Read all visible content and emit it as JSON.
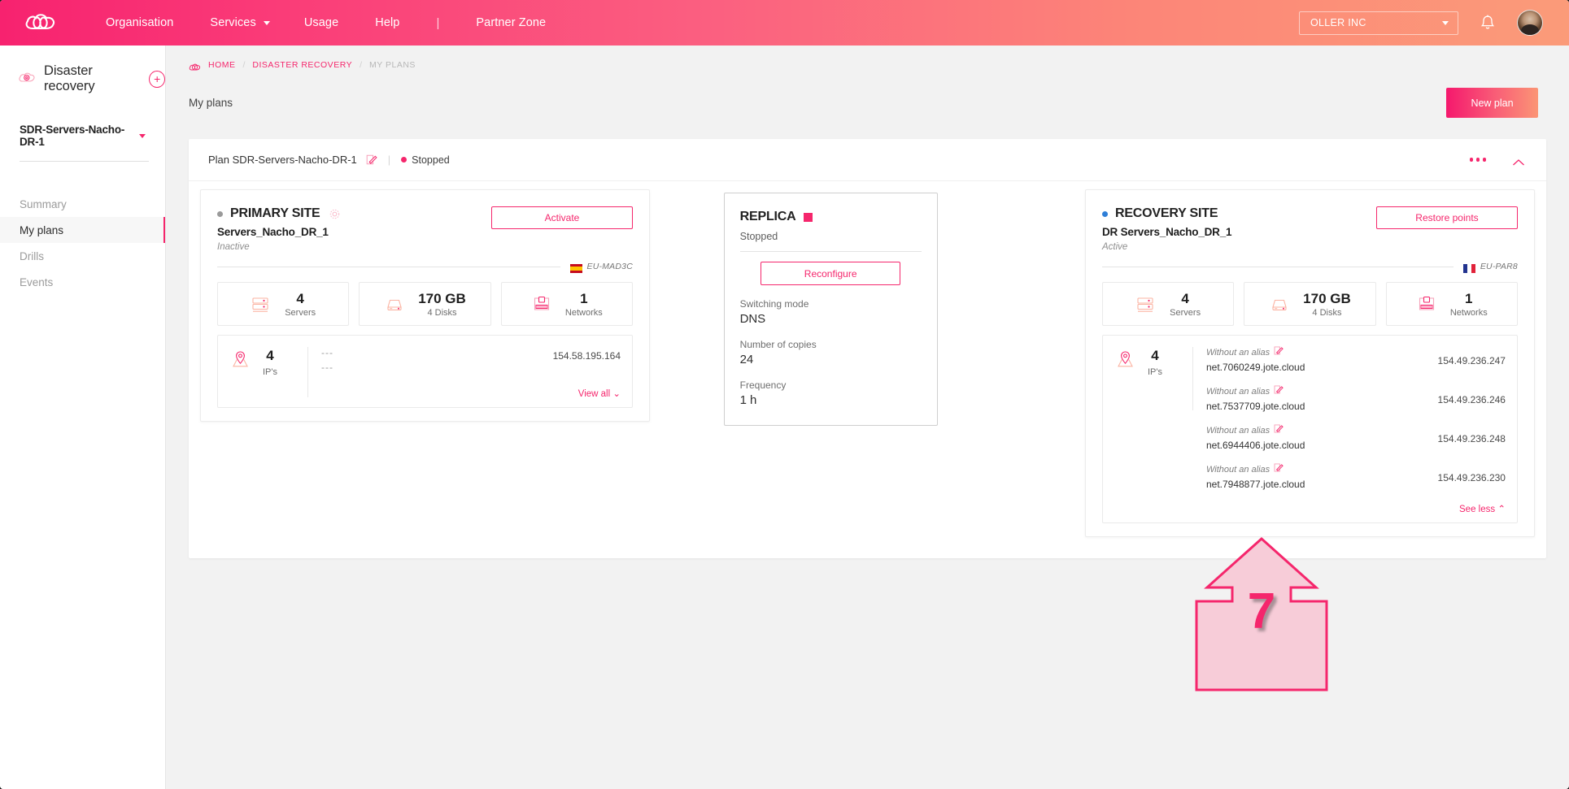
{
  "topnav": {
    "logo_icon": "cloud-logo-icon",
    "links": [
      {
        "label": "Organisation",
        "caret": false
      },
      {
        "label": "Services",
        "caret": true
      },
      {
        "label": "Usage",
        "caret": false
      },
      {
        "label": "Help",
        "caret": false
      }
    ],
    "separator": "|",
    "partner_link": "Partner Zone",
    "org_selector": "OLLER INC",
    "bell_icon": "notification-bell-icon",
    "avatar_icon": "user-avatar"
  },
  "sidebar": {
    "service_icon": "disaster-recovery-cloud-icon",
    "service_title": "Disaster recovery",
    "add_label": "+",
    "plan_selector": "SDR-Servers-Nacho-DR-1",
    "items": [
      {
        "label": "Summary",
        "active": false
      },
      {
        "label": "My plans",
        "active": true
      },
      {
        "label": "Drills",
        "active": false
      },
      {
        "label": "Events",
        "active": false
      }
    ]
  },
  "breadcrumb": {
    "home_icon": "home-cloud-icon",
    "items": [
      "HOME",
      "DISASTER RECOVERY",
      "MY PLANS"
    ],
    "separator": "/"
  },
  "page": {
    "title": "My plans",
    "new_plan_label": "New plan"
  },
  "plan_bar": {
    "title": "Plan SDR-Servers-Nacho-DR-1",
    "edit_icon": "edit-pencil-icon",
    "separator": "|",
    "status": "Stopped",
    "status_color": "#f5266c",
    "more_icon": "more-options-icon",
    "collapse_icon": "chevron-up-icon"
  },
  "primary_site": {
    "bullet_color": "#9a9a9a",
    "title": "PRIMARY SITE",
    "gear_icon": "gear-icon",
    "name": "Servers_Nacho_DR_1",
    "state": "Inactive",
    "action_label": "Activate",
    "flag_icon": "flag-spain-icon",
    "region": "EU-MAD3C",
    "stats": [
      {
        "icon": "server-rack-icon",
        "value": "4",
        "label": "Servers"
      },
      {
        "icon": "disk-icon",
        "value": "170 GB",
        "label": "4 Disks"
      },
      {
        "icon": "network-icon",
        "value": "1",
        "label": "Networks"
      }
    ],
    "ip_icon": "map-pin-icon",
    "ip_count": "4",
    "ip_label": "IP's",
    "ip_entries": [
      {
        "alias": "---",
        "host": "---",
        "ip": "154.58.195.164"
      }
    ],
    "expand_label": "View all"
  },
  "replica": {
    "title": "REPLICA",
    "status_color": "#f5266c",
    "state": "Stopped",
    "reconfigure_label": "Reconfigure",
    "fields": [
      {
        "label": "Switching mode",
        "value": "DNS"
      },
      {
        "label": "Number of copies",
        "value": "24"
      },
      {
        "label": "Frequency",
        "value": "1 h"
      }
    ]
  },
  "recovery_site": {
    "bullet_color": "#2f7fd8",
    "title": "RECOVERY SITE",
    "name": "DR Servers_Nacho_DR_1",
    "state": "Active",
    "action_label": "Restore points",
    "flag_icon": "flag-france-icon",
    "region": "EU-PAR8",
    "stats": [
      {
        "icon": "server-rack-icon",
        "value": "4",
        "label": "Servers"
      },
      {
        "icon": "disk-icon",
        "value": "170 GB",
        "label": "4 Disks"
      },
      {
        "icon": "network-icon",
        "value": "1",
        "label": "Networks"
      }
    ],
    "ip_icon": "map-pin-icon",
    "ip_count": "4",
    "ip_label": "IP's",
    "alias_placeholder": "Without an alias",
    "alias_edit_icon": "edit-pencil-icon",
    "ip_entries": [
      {
        "alias": "Without an alias",
        "host": "net.7060249.jote.cloud",
        "ip": "154.49.236.247"
      },
      {
        "alias": "Without an alias",
        "host": "net.7537709.jote.cloud",
        "ip": "154.49.236.246"
      },
      {
        "alias": "Without an alias",
        "host": "net.6944406.jote.cloud",
        "ip": "154.49.236.248"
      },
      {
        "alias": "Without an alias",
        "host": "net.7948877.jote.cloud",
        "ip": "154.49.236.230"
      }
    ],
    "collapse_label": "See less"
  },
  "annotation": {
    "step_number": "7",
    "fill_color": "#f7ccd8",
    "stroke_color": "#f5266c"
  }
}
